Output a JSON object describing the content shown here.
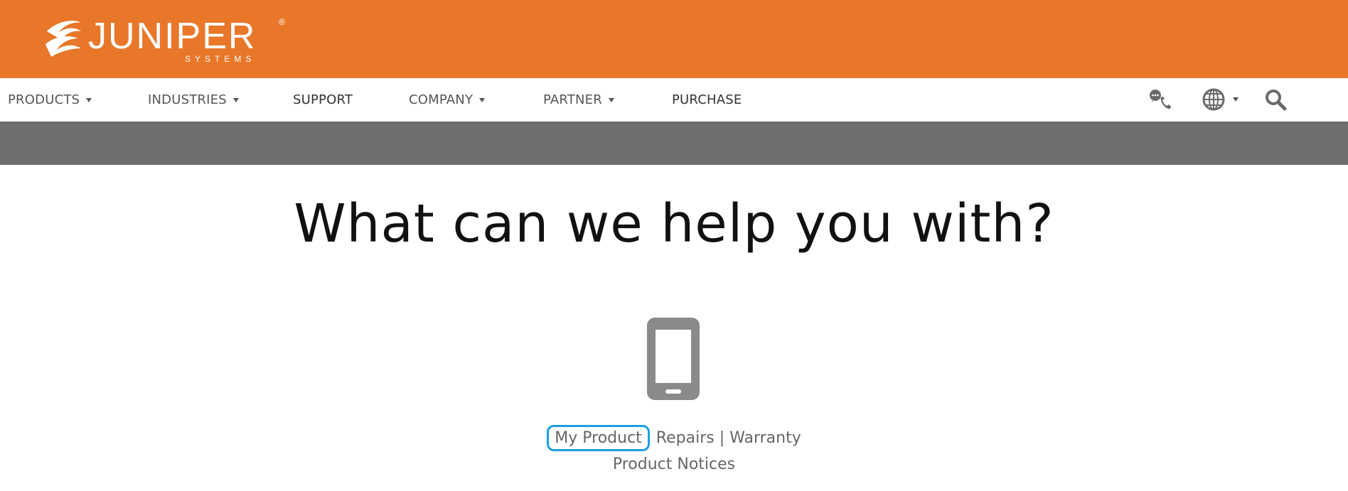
{
  "brand": {
    "name": "JUNIPER",
    "sub": "SYSTEMS",
    "registered": "®",
    "header_color": "#E87729"
  },
  "nav": {
    "items": [
      {
        "label": "PRODUCTS",
        "dropdown": true
      },
      {
        "label": "INDUSTRIES",
        "dropdown": true
      },
      {
        "label": "SUPPORT",
        "dropdown": false
      },
      {
        "label": "COMPANY",
        "dropdown": true
      },
      {
        "label": "PARTNER",
        "dropdown": true
      },
      {
        "label": "PURCHASE",
        "dropdown": false
      }
    ],
    "icons": [
      "contact-phone-icon",
      "globe-language-icon",
      "search-icon"
    ]
  },
  "hero": {
    "banner_color": "#6E6E6E",
    "headline": "What can we help you with?"
  },
  "support": {
    "icon": "smartphone-icon",
    "links": {
      "my_product": "My Product",
      "repairs": "Repairs",
      "separator": "|",
      "warranty": "Warranty",
      "product_notices": "Product Notices"
    },
    "focus_color": "#1BA0E1"
  }
}
